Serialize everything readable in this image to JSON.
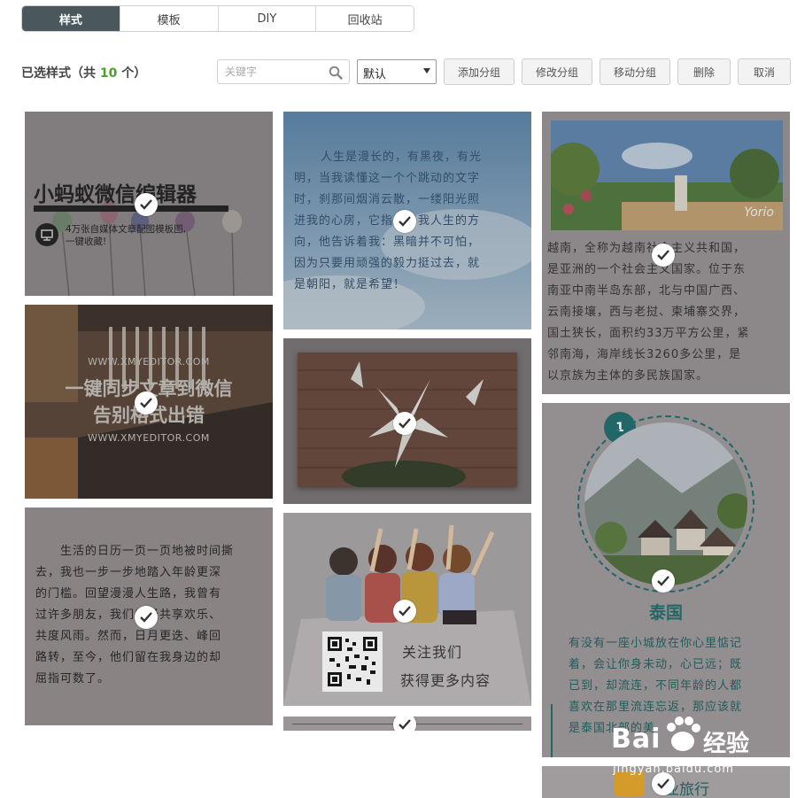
{
  "tabs": [
    {
      "label": "样式",
      "active": true
    },
    {
      "label": "模板",
      "active": false
    },
    {
      "label": "DIY",
      "active": false
    },
    {
      "label": "回收站",
      "active": false
    }
  ],
  "toolbar": {
    "selected_prefix": "已选样式（共 ",
    "selected_count": "10",
    "selected_suffix": " 个）",
    "search_placeholder": "关键字",
    "sort_value": "默认",
    "buttons": [
      "添加分组",
      "修改分组",
      "移动分组",
      "删除",
      "取消"
    ]
  },
  "cards": {
    "c1": {
      "title": "小蚂蚁微信编辑器",
      "subtitle_line1": "4万张自媒体文章配图模板图,",
      "subtitle_line2": "一键收藏!"
    },
    "c2": {
      "text": "人生是漫长的，有黑夜，有光明，当我读懂这一个个跳动的文字时，刹那间烟消云散，一缕阳光照进我的心房，它指引着我人生的方向，他告诉着我：黑暗并不可怕，因为只要用顽强的毅力挺过去，就是朝阳，就是希望！",
      "lines": [
        "人生是漫长的，有黑夜，有光",
        "明，当我读懂这一个个跳动的文字",
        "时，刹那间烟消云散，一缕阳光照",
        "进我的心房，它指引着我人生的方",
        "向，他告诉着我：黑暗并不可怕，",
        "因为只要用顽强的毅力挺过去，就",
        "是朝阳，就是希望！"
      ]
    },
    "c3": {
      "photo_text": "Yorio",
      "lines": [
        "越南，全称为越南社会主义共和国，",
        "是亚洲的一个社会主义国家。位于东",
        "南亚中南半岛东部，北与中国广西、",
        "云南接壤，西与老挝、柬埔寨交界，",
        "国土狭长，面积约33万平方公里，紧",
        "邻南海，海岸线长3260多公里，是",
        "以京族为主体的多民族国家。"
      ]
    },
    "c4": {
      "url1": "WWW.XMYEDITOR.COM",
      "line1": "一键同步文章到微信",
      "line2": "告别格式出错",
      "url2": "WWW.XMYEDITOR.COM"
    },
    "c6": {
      "lines": [
        "生活的日历一页一页地被时间撕",
        "去，我也一步一步地踏入年龄更深",
        "的门槛。回望漫漫人生路，我曾有",
        "过许多朋友，我们曾经共享欢乐、",
        "共度风雨。然而，日月更迭、峰回",
        "路转，至今，他们留在我身边的却",
        "屈指可数了。"
      ]
    },
    "c7": {
      "line1": "关注我们",
      "line2": "获得更多内容"
    },
    "c8": {
      "badge": "1",
      "title": "泰国",
      "lines": [
        "有没有一座小城放在你心里惦记",
        "着，会让你身未动，心已远；既",
        "已到，却流连，不同年龄的人都",
        "喜欢在那里流连忘返，那应该就",
        "是泰国北部的美"
      ]
    },
    "c10": {
      "title": "业旅行"
    }
  },
  "watermark": {
    "brand": "Bai",
    "brand2": "经验",
    "url": "jingyan.baidu.com"
  },
  "colors": {
    "tab_active": "#4a585c",
    "count_green": "#4aa028",
    "teal": "#1f6b6b"
  }
}
